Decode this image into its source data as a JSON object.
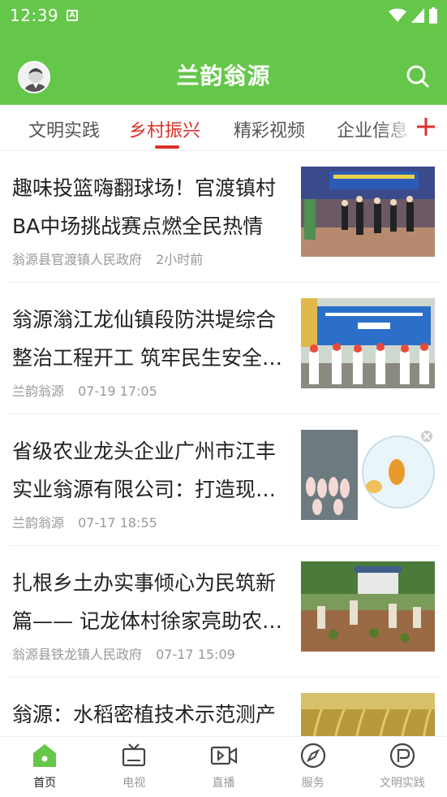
{
  "status_bar": {
    "time": "12:39",
    "app_icon": "A"
  },
  "header": {
    "title": "兰韵翁源"
  },
  "tabs": [
    {
      "label": "文明实践",
      "active": false
    },
    {
      "label": "乡村振兴",
      "active": true
    },
    {
      "label": "精彩视频",
      "active": false
    },
    {
      "label": "企业信息",
      "active": false
    }
  ],
  "news": [
    {
      "title": "趣味投篮嗨翻球场！官渡镇村BA中场挑战赛点燃全民热情",
      "source": "翁源县官渡镇人民政府",
      "time": "2小时前"
    },
    {
      "title": "翁源滃江龙仙镇段防洪堤综合整治工程开工 筑牢民生安全防线",
      "source": "兰韵翁源",
      "time": "07-19 17:05"
    },
    {
      "title": "省级农业龙头企业广州市江丰实业翁源有限公司：打造现代农业",
      "source": "兰韵翁源",
      "time": "07-17 18:55"
    },
    {
      "title": "扎根乡土办实事倾心为民筑新篇—— 记龙体村徐家亮助农事迹",
      "source": "翁源县铁龙镇人民政府",
      "time": "07-17 15:09"
    },
    {
      "title": "翁源：水稻密植技术示范测产",
      "source": "",
      "time": ""
    }
  ],
  "bottom_nav": [
    {
      "label": "首页",
      "icon": "home-icon",
      "active": true
    },
    {
      "label": "电视",
      "icon": "tv-icon",
      "active": false
    },
    {
      "label": "直播",
      "icon": "live-video-icon",
      "active": false
    },
    {
      "label": "服务",
      "icon": "compass-icon",
      "active": false
    },
    {
      "label": "文明实践",
      "icon": "civilization-icon",
      "active": false
    }
  ],
  "colors": {
    "brand_green": "#65c74a",
    "active_red": "#d9322a"
  }
}
